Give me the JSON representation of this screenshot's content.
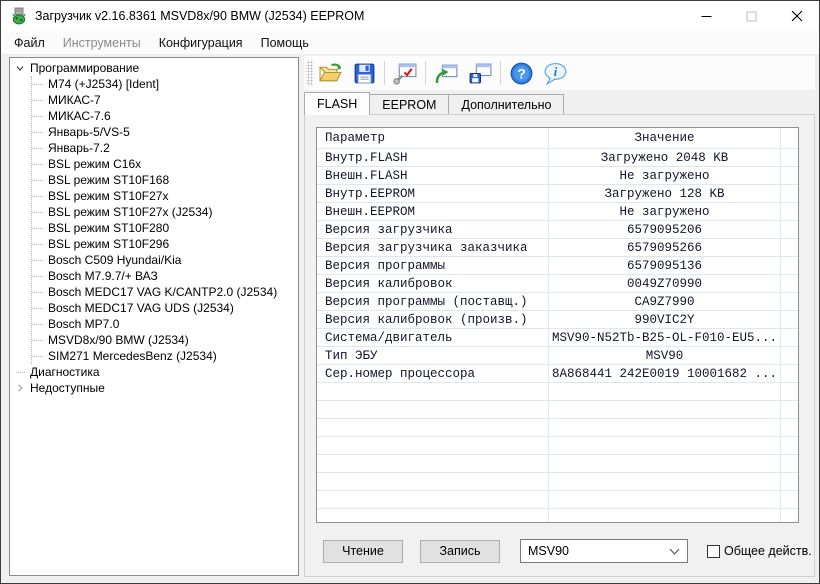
{
  "window": {
    "title": "Загрузчик v2.16.8361 MSVD8x/90 BMW (J2534) EEPROM",
    "controls": {
      "minimize": "minimize",
      "maximize": "maximize",
      "close": "close"
    }
  },
  "menu": {
    "items": [
      {
        "label": "Файл",
        "enabled": true
      },
      {
        "label": "Инструменты",
        "enabled": false
      },
      {
        "label": "Конфигурация",
        "enabled": true
      },
      {
        "label": "Помощь",
        "enabled": true
      }
    ]
  },
  "tree": {
    "nodes": [
      {
        "label": "Программирование",
        "state": "expanded",
        "children": [
          "M74 (+J2534) [Ident]",
          "МИКАС-7",
          "МИКАС-7.6",
          "Январь-5/VS-5",
          "Январь-7.2",
          "BSL режим C16x",
          "BSL режим ST10F168",
          "BSL режим ST10F27x",
          "BSL режим ST10F27x (J2534)",
          "BSL режим ST10F280",
          "BSL режим ST10F296",
          "Bosch C509 Hyundai/Kia",
          "Bosch M7.9.7/+ ВАЗ",
          "Bosch MEDC17 VAG K/CANTP2.0 (J2534)",
          "Bosch MEDC17 VAG UDS (J2534)",
          "Bosch MP7.0",
          "MSVD8x/90 BMW (J2534)",
          "SIM271 MercedesBenz (J2534)"
        ]
      },
      {
        "label": "Диагностика",
        "state": "leaf",
        "children": []
      },
      {
        "label": "Недоступные",
        "state": "collapsed",
        "children": []
      }
    ]
  },
  "toolbar": {
    "buttons": [
      "open-file",
      "save-file",
      "verify-settings",
      "read-from-ecu",
      "write-to-ecu",
      "help",
      "about"
    ]
  },
  "tabs": [
    {
      "label": "FLASH",
      "active": true
    },
    {
      "label": "EEPROM",
      "active": false
    },
    {
      "label": "Дополнительно",
      "active": false
    }
  ],
  "table": {
    "headers": [
      "Параметр",
      "Значение"
    ],
    "rows": [
      [
        "Внутр.FLASH",
        "Загружено 2048 KB"
      ],
      [
        "Внешн.FLASH",
        "Не загружено"
      ],
      [
        "Внутр.EEPROM",
        "Загружено 128 KB"
      ],
      [
        "Внешн.EEPROM",
        "Не загружено"
      ],
      [
        "Версия загрузчика",
        "6579095206"
      ],
      [
        "Версия загрузчика заказчика",
        "6579095266"
      ],
      [
        "Версия программы",
        "6579095136"
      ],
      [
        "Версия калибровок",
        "0049Z70990"
      ],
      [
        "Версия программы (поставщ.)",
        "CA9Z7990"
      ],
      [
        "Версия калибровок (произв.)",
        "990VIC2Y"
      ],
      [
        "Система/двигатель",
        "MSV90-N52Tb-B25-OL-F010-EU5..."
      ],
      [
        "Тип ЭБУ",
        "MSV90"
      ],
      [
        "Сер.номер процессора",
        "8A868441 242E0019 10001682 ..."
      ]
    ],
    "empty_row_count": 9
  },
  "footer": {
    "read_button": "Чтение",
    "write_button": "Запись",
    "combo_value": "MSV90",
    "checkbox_label": "Общее действ.",
    "checkbox_checked": false
  }
}
